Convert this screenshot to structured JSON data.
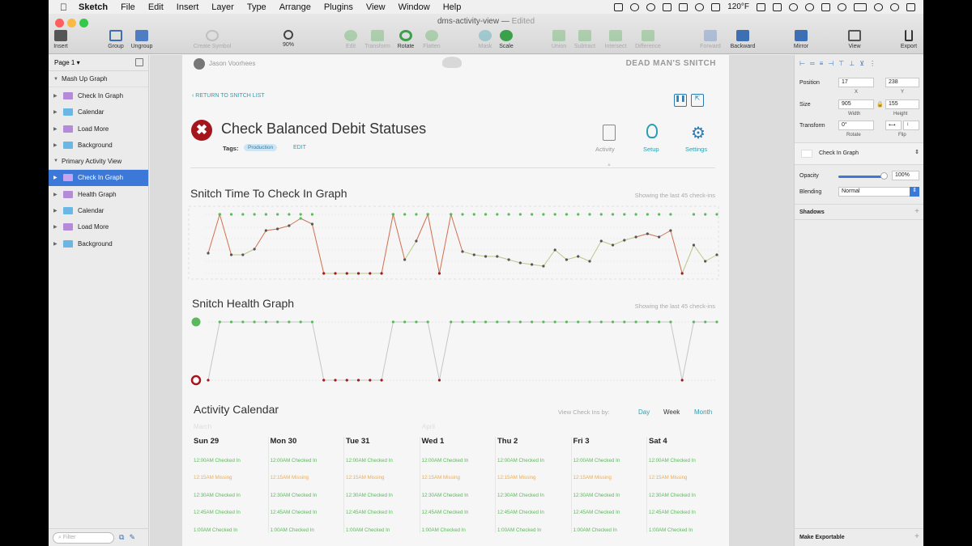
{
  "menubar": {
    "app": "Sketch",
    "items": [
      "File",
      "Edit",
      "Insert",
      "Layer",
      "Type",
      "Arrange",
      "Plugins",
      "View",
      "Window",
      "Help"
    ],
    "temperature": "120°F"
  },
  "window": {
    "document": "dms-activity-view",
    "status": "Edited"
  },
  "toolbar": {
    "insert": "Insert",
    "group": "Group",
    "ungroup": "Ungroup",
    "create_symbol": "Create Symbol",
    "zoom": "90%",
    "edit": "Edit",
    "transform": "Transform",
    "rotate": "Rotate",
    "flatten": "Flatten",
    "mask": "Mask",
    "scale": "Scale",
    "union": "Union",
    "subtract": "Subtract",
    "intersect": "Intersect",
    "difference": "Difference",
    "forward": "Forward",
    "backward": "Backward",
    "mirror": "Mirror",
    "view": "View",
    "export": "Export"
  },
  "layers": {
    "page": "Page 1",
    "groups": [
      {
        "name": "Mash Up Graph",
        "children": [
          "Check In Graph",
          "Calendar",
          "Load More",
          "Background"
        ]
      },
      {
        "name": "Primary Activity View",
        "children": [
          "Check In Graph",
          "Health Graph",
          "Calendar",
          "Load More",
          "Background"
        ]
      }
    ],
    "filter_placeholder": "Filter"
  },
  "artboard": {
    "user": "Jason Voorhees",
    "logo": "DEAD MAN'S SNITCH",
    "back_link": "‹ RETURN TO SNITCH LIST",
    "snitch_title": "Check Balanced Debit Statuses",
    "tags_label": "Tags:",
    "tag": "Production",
    "tag_edit": "EDIT",
    "tabs": [
      "Activity",
      "Setup",
      "Settings"
    ],
    "timegraph": {
      "title": "Snitch Time To Check In Graph",
      "note": "Showing the last 45 check-ins"
    },
    "healthgraph": {
      "title": "Snitch Health Graph",
      "note": "Showing the last 45 check-ins"
    },
    "calendar": {
      "title": "Activity Calendar",
      "view_label": "View Check Ins by:",
      "view_options": [
        "Day",
        "Week",
        "Month"
      ],
      "months": [
        "March",
        "April"
      ],
      "days": [
        "Sun 29",
        "Mon 30",
        "Tue 31",
        "Wed 1",
        "Thu 2",
        "Fri 3",
        "Sat 4"
      ],
      "slots": [
        {
          "time": "12:00AM",
          "status": "Checked In"
        },
        {
          "time": "12:15AM",
          "status": "Missing"
        },
        {
          "time": "12:30AM",
          "status": "Checked In"
        },
        {
          "time": "12:45AM",
          "status": "Checked In"
        },
        {
          "time": "1:00AM",
          "status": "Checked In"
        }
      ]
    }
  },
  "inspector": {
    "position_label": "Position",
    "x": "17",
    "y": "238",
    "x_lbl": "X",
    "y_lbl": "Y",
    "size_label": "Size",
    "width": "905",
    "height": "155",
    "w_lbl": "Width",
    "h_lbl": "Height",
    "transform_label": "Transform",
    "rotate": "0°",
    "rotate_lbl": "Rotate",
    "flip_lbl": "Flip",
    "style": "Check In Graph",
    "opacity_label": "Opacity",
    "opacity": "100%",
    "blending_label": "Blending",
    "blending": "Normal",
    "shadows": "Shadows",
    "exportable": "Make Exportable"
  },
  "colors": {
    "selection": "#3b78d8",
    "ok": "#5cb85c",
    "missing": "#f0ad4e",
    "error": "#a5151c",
    "teal": "#2a9fb2"
  },
  "graph_data": {
    "time_y": [
      67,
      0,
      0,
      0,
      0,
      0,
      0,
      0,
      0,
      0,
      0,
      0,
      0,
      0,
      0,
      0,
      0,
      0,
      0,
      0,
      0,
      0,
      0,
      0,
      0,
      0,
      0,
      0,
      0,
      0,
      0,
      0,
      0,
      0,
      0,
      0,
      0,
      0,
      0,
      0,
      0,
      0,
      0,
      0,
      0
    ],
    "time_pattern": [
      "mid",
      "top",
      "top",
      "top",
      "top",
      "top",
      "top",
      "top",
      "top",
      "top",
      "bot",
      "bot",
      "bot",
      "bot",
      "bot",
      "bot",
      "top",
      "top",
      "top",
      "top",
      "bot",
      "top",
      "top",
      "top",
      "top",
      "top",
      "top",
      "top",
      "top",
      "top",
      "top",
      "top",
      "top",
      "top",
      "top",
      "top",
      "top",
      "top",
      "top",
      "top",
      "top",
      "bot",
      "top",
      "top",
      "top"
    ],
    "health": [
      "bad",
      "good",
      "good",
      "good",
      "good",
      "good",
      "good",
      "good",
      "good",
      "good",
      "bad",
      "bad",
      "bad",
      "bad",
      "bad",
      "bad",
      "good",
      "good",
      "good",
      "good",
      "bad",
      "good",
      "good",
      "good",
      "good",
      "good",
      "good",
      "good",
      "good",
      "good",
      "good",
      "good",
      "good",
      "good",
      "good",
      "good",
      "good",
      "good",
      "good",
      "good",
      "good",
      "bad",
      "good",
      "good",
      "good"
    ]
  }
}
